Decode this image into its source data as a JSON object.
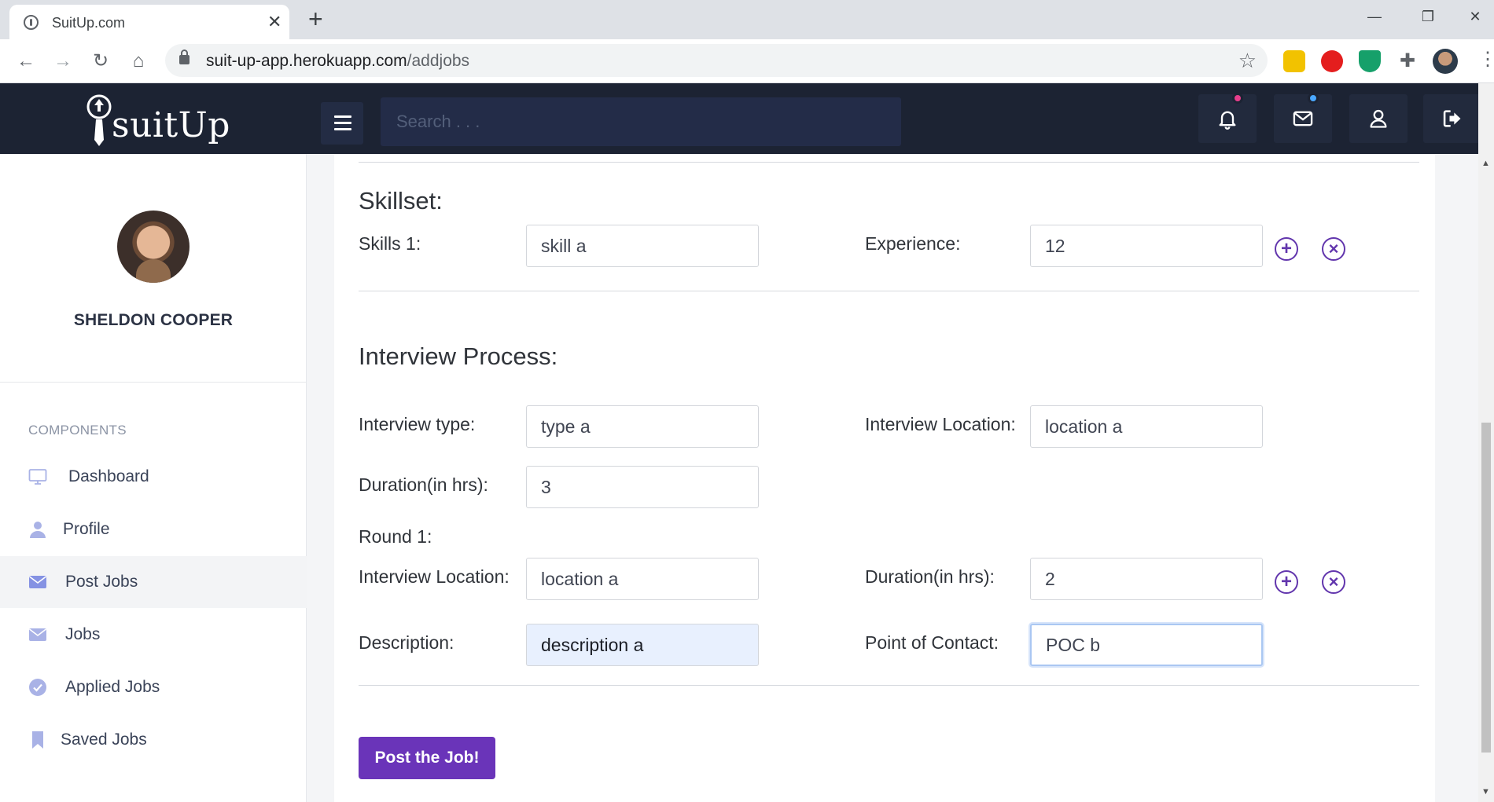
{
  "browser": {
    "tab_title": "SuitUp.com",
    "url_domain": "suit-up-app.herokuapp.com",
    "url_path": "/addjobs"
  },
  "header": {
    "logo_text": "suitUp",
    "search_placeholder": "Search . . .",
    "notification_dot_color": "#e83e8c",
    "mail_dot_color": "#4aa8ff"
  },
  "sidebar": {
    "user_name": "SHELDON COOPER",
    "section_label": "COMPONENTS",
    "items": [
      {
        "label": "Dashboard",
        "icon": "monitor-icon"
      },
      {
        "label": "Profile",
        "icon": "user-icon"
      },
      {
        "label": "Post Jobs",
        "icon": "envelope-icon",
        "active": true
      },
      {
        "label": "Jobs",
        "icon": "envelope-icon"
      },
      {
        "label": "Applied Jobs",
        "icon": "check-circle-icon"
      },
      {
        "label": "Saved Jobs",
        "icon": "bookmark-icon"
      }
    ]
  },
  "form": {
    "skillset": {
      "title": "Skillset:",
      "skill_label": "Skills 1:",
      "skill_value": "skill a",
      "experience_label": "Experience:",
      "experience_value": "12"
    },
    "interview": {
      "title": "Interview Process:",
      "type_label": "Interview type:",
      "type_value": "type a",
      "location_label": "Interview Location:",
      "location_value": "location a",
      "duration_label": "Duration(in hrs):",
      "duration_value": "3"
    },
    "round": {
      "title": "Round 1:",
      "location_label": "Interview Location:",
      "location_value": "location a",
      "duration_label": "Duration(in hrs):",
      "duration_value": "2",
      "description_label": "Description:",
      "description_value": "description a",
      "poc_label": "Point of Contact:",
      "poc_value": "POC b"
    },
    "add_symbol": "+",
    "remove_symbol": "×",
    "submit_label": "Post the Job!",
    "accent_color": "#6a34b9"
  }
}
